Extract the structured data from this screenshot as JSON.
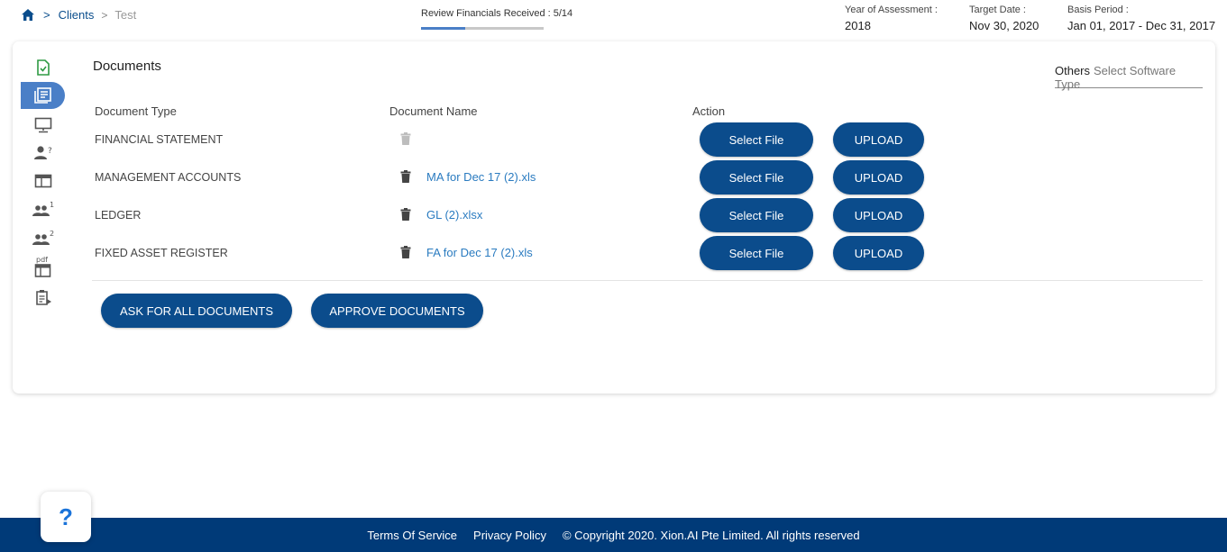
{
  "breadcrumb": {
    "home_icon": "home-icon",
    "clients_label": "Clients",
    "current_label": "Test"
  },
  "progress": {
    "label": "Review Financials Received : 5/14",
    "received": 5,
    "total": 14
  },
  "meta": {
    "year_label": "Year of Assessment :",
    "year_value": "2018",
    "target_label": "Target Date :",
    "target_value": "Nov 30, 2020",
    "basis_label": "Basis Period :",
    "basis_value": "Jan 01, 2017 - Dec 31, 2017"
  },
  "sidebar": {
    "items": [
      {
        "icon": "file-check-icon",
        "active": false,
        "color": "#2e9a43"
      },
      {
        "icon": "documents-icon",
        "active": true,
        "color": "#ffffff"
      },
      {
        "icon": "monitor-icon",
        "active": false,
        "color": "#555555"
      },
      {
        "icon": "person-question-icon",
        "active": false,
        "badge": "?"
      },
      {
        "icon": "table-icon",
        "active": false
      },
      {
        "icon": "people-1-icon",
        "active": false,
        "badge": "1"
      },
      {
        "icon": "people-2-icon",
        "active": false,
        "badge": "2"
      },
      {
        "icon": "pdf-table-icon",
        "active": false,
        "badge": "pdf"
      },
      {
        "icon": "clipboard-play-icon",
        "active": false
      }
    ]
  },
  "documents": {
    "title": "Documents",
    "software": {
      "selected": "Others",
      "placeholder": "Select Software Type"
    },
    "columns": {
      "type": "Document Type",
      "name": "Document Name",
      "action": "Action"
    },
    "rows": [
      {
        "type": "FINANCIAL STATEMENT",
        "name": "",
        "has_file": false
      },
      {
        "type": "MANAGEMENT ACCOUNTS",
        "name": "MA for Dec 17 (2).xls",
        "has_file": true
      },
      {
        "type": "LEDGER",
        "name": "GL (2).xlsx",
        "has_file": true
      },
      {
        "type": "FIXED ASSET REGISTER",
        "name": "FA for Dec 17 (2).xls",
        "has_file": true
      }
    ],
    "select_label": "Select File",
    "upload_label": "UPLOAD",
    "ask_all_label": "ASK FOR ALL DOCUMENTS",
    "approve_label": "APPROVE DOCUMENTS"
  },
  "help": {
    "label": "?"
  },
  "footer": {
    "terms": "Terms Of Service",
    "privacy": "Privacy Policy",
    "copyright": "© Copyright 2020. Xion.AI Pte Limited. All rights reserved"
  },
  "colors": {
    "primary": "#0b4c8c",
    "accent": "#4a7fc7",
    "link": "#2a7bc0",
    "footer": "#003a78"
  }
}
